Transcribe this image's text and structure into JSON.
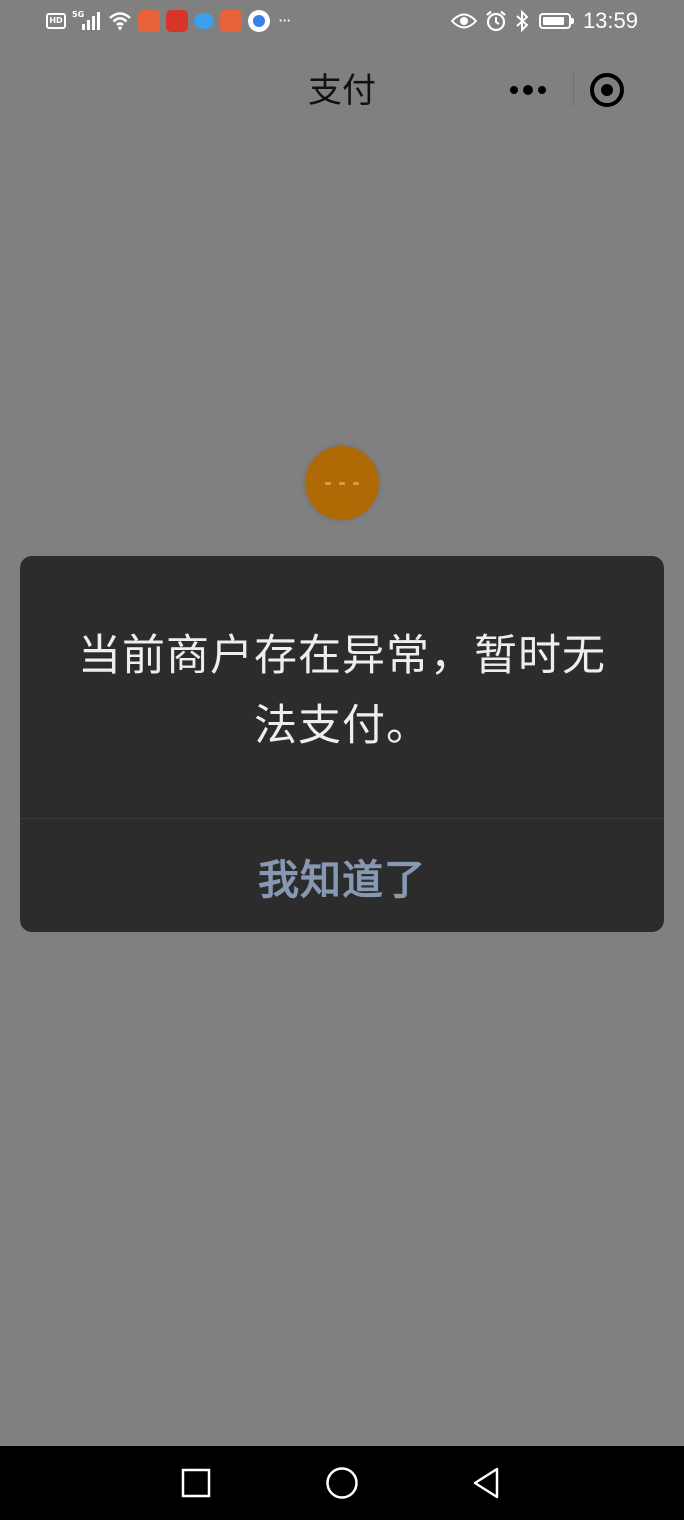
{
  "status_bar": {
    "hd_label": "HD",
    "network_label": "5G",
    "time": "13:59",
    "battery_level": 0.9,
    "left_icons": [
      "hd-icon",
      "signal-icon",
      "wifi-icon",
      "app-notification-icon",
      "app-notification-icon",
      "cloud-icon",
      "app-notification-icon",
      "browser-icon",
      "more-notifications-icon"
    ],
    "right_icons": [
      "eye-icon",
      "alarm-icon",
      "bluetooth-icon",
      "battery-icon"
    ]
  },
  "nav": {
    "title": "支付",
    "more_icon": "more-dots-icon",
    "close_icon": "target-close-icon"
  },
  "loading": {
    "color": "#b06a05"
  },
  "modal": {
    "message": "当前商户存在异常，暂时无法支付。",
    "button_label": "我知道了",
    "button_color": "#8799b2",
    "background": "#2c2c2c"
  },
  "system_nav": {
    "icons": [
      "recents-square-icon",
      "home-circle-icon",
      "back-triangle-icon"
    ]
  },
  "colors": {
    "overlay_background": "#808080",
    "nav_bar_background": "#000000"
  }
}
